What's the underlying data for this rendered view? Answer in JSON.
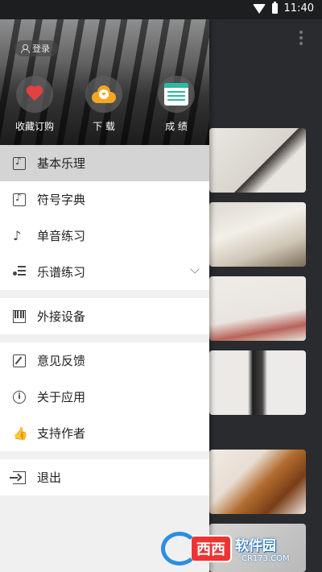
{
  "status_bar": {
    "time": "11:40"
  },
  "drawer": {
    "login_label": "登录",
    "quick_actions": [
      {
        "label": "收藏订购",
        "icon": "heart-icon"
      },
      {
        "label": "下 载",
        "icon": "cloud-download-icon"
      },
      {
        "label": "成 绩",
        "icon": "score-sheet-icon"
      }
    ],
    "menu": [
      {
        "label": "基本乐理",
        "icon": "music-note-box-icon",
        "active": true
      },
      {
        "label": "符号字典",
        "icon": "music-book-icon"
      },
      {
        "label": "单音练习",
        "icon": "eighth-note-icon"
      },
      {
        "label": "乐谱练习",
        "icon": "music-list-icon",
        "expandable": true
      },
      {
        "label": "外接设备",
        "icon": "piano-keys-icon"
      },
      {
        "label": "意见反馈",
        "icon": "edit-icon"
      },
      {
        "label": "关于应用",
        "icon": "info-icon"
      },
      {
        "label": "支持作者",
        "icon": "thumbs-up-icon"
      },
      {
        "label": "退出",
        "icon": "exit-icon"
      }
    ]
  },
  "watermark": {
    "badge": "西西",
    "title": "软件园",
    "subtitle": "CR173.COM"
  },
  "colors": {
    "drawer_bg": "#f0f0f0",
    "active_item": "#d4d4d4",
    "heart": "#e34141",
    "download": "#f5a623",
    "score": "#2fb7a4"
  }
}
